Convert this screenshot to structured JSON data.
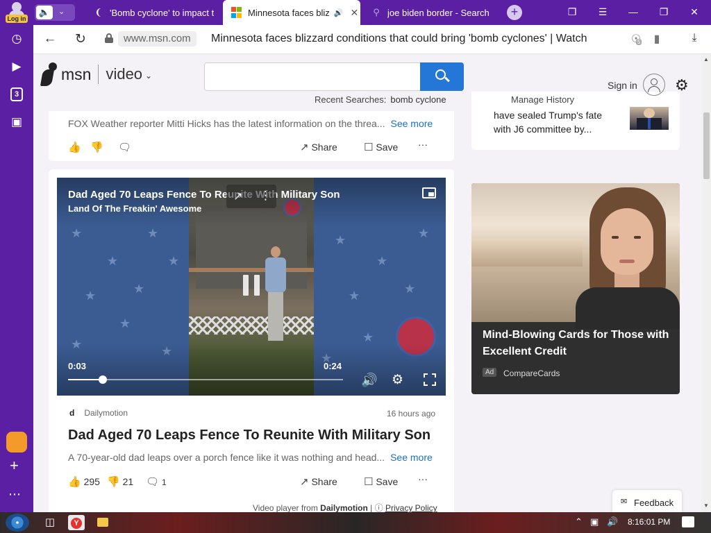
{
  "browser": {
    "profile_label": "Log in",
    "tabs": [
      {
        "title": "'Bomb cyclone' to impact t",
        "active": false
      },
      {
        "title": "Minnesota faces bliz",
        "active": true
      },
      {
        "title": "joe biden border - Search",
        "active": false
      }
    ],
    "address_domain": "www.msn.com",
    "address_title": "Minnesota faces blizzard conditions that could bring 'bomb cyclones' | Watch",
    "protect_badge": "5",
    "sidebar_badge": "3"
  },
  "header": {
    "logo_text": "msn",
    "section": "video",
    "search_placeholder": "",
    "recent_label": "Recent Searches:",
    "recent_term": "bomb cyclone",
    "manage_history": "Manage History",
    "sign_in": "Sign in"
  },
  "feed": {
    "prev_card": {
      "description": "FOX Weather reporter Mitti Hicks has the latest information on the threa...",
      "see_more": "See more",
      "share": "Share",
      "save": "Save",
      "more": "···"
    },
    "video": {
      "overlay_title": "Dad Aged 70 Leaps Fence To Reunite With Military Son",
      "channel": "Land Of The Freakin' Awesome",
      "current_time": "0:03",
      "duration": "0:24",
      "progress": 0.125,
      "source_logo": "d",
      "source": "Dailymotion",
      "timestamp": "16 hours ago",
      "headline": "Dad Aged 70 Leaps Fence To Reunite With Military Son",
      "description": "A 70-year-old dad leaps over a porch fence like it was nothing and head...",
      "see_more": "See more",
      "likes": "295",
      "dislikes": "21",
      "comments": "1",
      "share": "Share",
      "save": "Save",
      "more": "···",
      "player_from_prefix": "Video player from",
      "player_from_brand": "Dailymotion",
      "privacy": "Privacy Policy"
    }
  },
  "right": {
    "news_text": "have sealed Trump's fate with J6 committee by...",
    "ad_title": "Mind-Blowing Cards for Those with Excellent Credit",
    "ad_badge": "Ad",
    "ad_source": "CompareCards"
  },
  "feedback": "Feedback",
  "taskbar": {
    "clock": "8:16:01 PM"
  },
  "colors": {
    "browser_purple": "#5b1fa4",
    "search_blue": "#2477d6",
    "link_blue": "#1a6fc9"
  }
}
